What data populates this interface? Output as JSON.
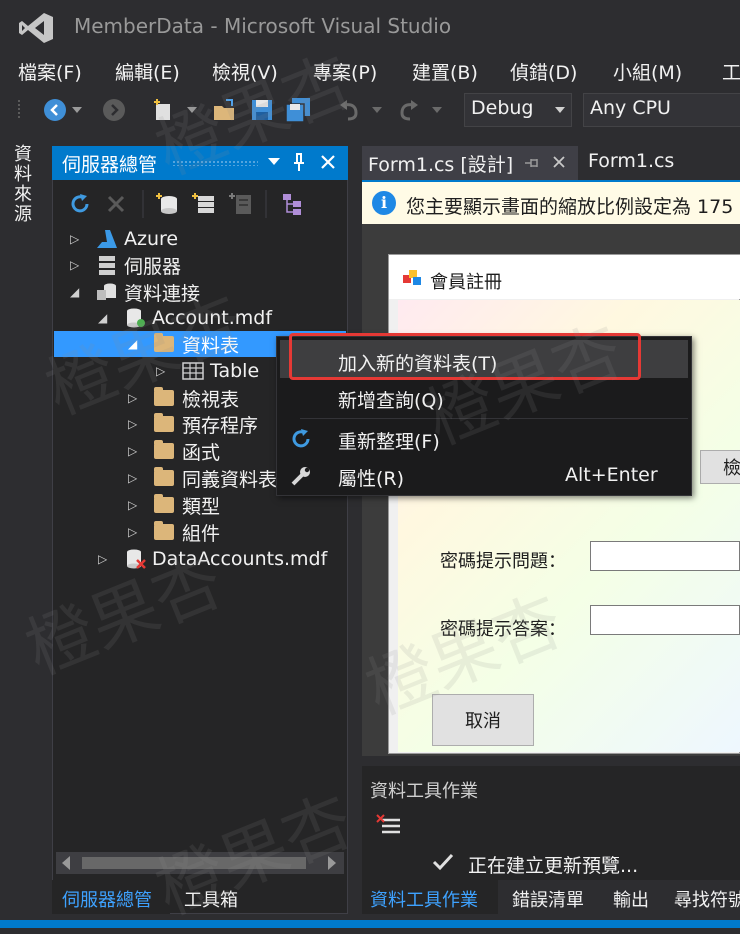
{
  "window": {
    "title": "MemberData - Microsoft Visual Studio"
  },
  "menu": {
    "items": [
      "檔案(F)",
      "編輯(E)",
      "檢視(V)",
      "專案(P)",
      "建置(B)",
      "偵錯(D)",
      "小組(M)",
      "工"
    ]
  },
  "toolbar": {
    "configuration": "Debug",
    "platform": "Any CPU"
  },
  "left_tool_tab": "資料來源",
  "server_explorer": {
    "title": "伺服器總管",
    "tree": [
      {
        "label": "Azure",
        "icon": "azure-icon"
      },
      {
        "label": "伺服器",
        "icon": "server-icon"
      },
      {
        "label": "資料連接",
        "icon": "data-connection-icon"
      },
      {
        "label": "Account.mdf",
        "icon": "database-icon"
      },
      {
        "label": "資料表",
        "icon": "folder-icon"
      },
      {
        "label": "Table",
        "icon": "table-icon"
      },
      {
        "label": "檢視表",
        "icon": "folder-icon"
      },
      {
        "label": "預存程序",
        "icon": "folder-icon"
      },
      {
        "label": "函式",
        "icon": "folder-icon"
      },
      {
        "label": "同義資料表",
        "icon": "folder-icon"
      },
      {
        "label": "類型",
        "icon": "folder-icon"
      },
      {
        "label": "組件",
        "icon": "folder-icon"
      },
      {
        "label": "DataAccounts.mdf",
        "icon": "database-error-icon"
      }
    ]
  },
  "bottom_tabs_left": [
    "伺服器總管",
    "工具箱"
  ],
  "doc_tabs": [
    "Form1.cs [設計]",
    "Form1.cs"
  ],
  "infobar": {
    "text": "您主要顯示畫面的縮放比例設定為 175"
  },
  "form": {
    "title": "會員註冊",
    "labels": [
      "密碼提示問題：",
      "密碼提示答案："
    ],
    "buttons": {
      "check": "檢",
      "cancel": "取消"
    }
  },
  "context_menu": {
    "items": [
      {
        "label": "加入新的資料表(T)",
        "shortcut": ""
      },
      {
        "label": "新增查詢(Q)",
        "shortcut": ""
      },
      {
        "label": "重新整理(F)",
        "shortcut": ""
      },
      {
        "label": "屬性(R)",
        "shortcut": "Alt+Enter"
      }
    ]
  },
  "data_tools": {
    "title": "資料工具作業",
    "status": "正在建立更新預覽..."
  },
  "bottom_tabs_right": [
    "資料工具作業",
    "錯誤清單",
    "輸出",
    "尋找符號"
  ],
  "watermark": "橙果杏",
  "colors": {
    "accent": "#007acc",
    "highlight": "#e53935",
    "selection": "#3399ff"
  }
}
